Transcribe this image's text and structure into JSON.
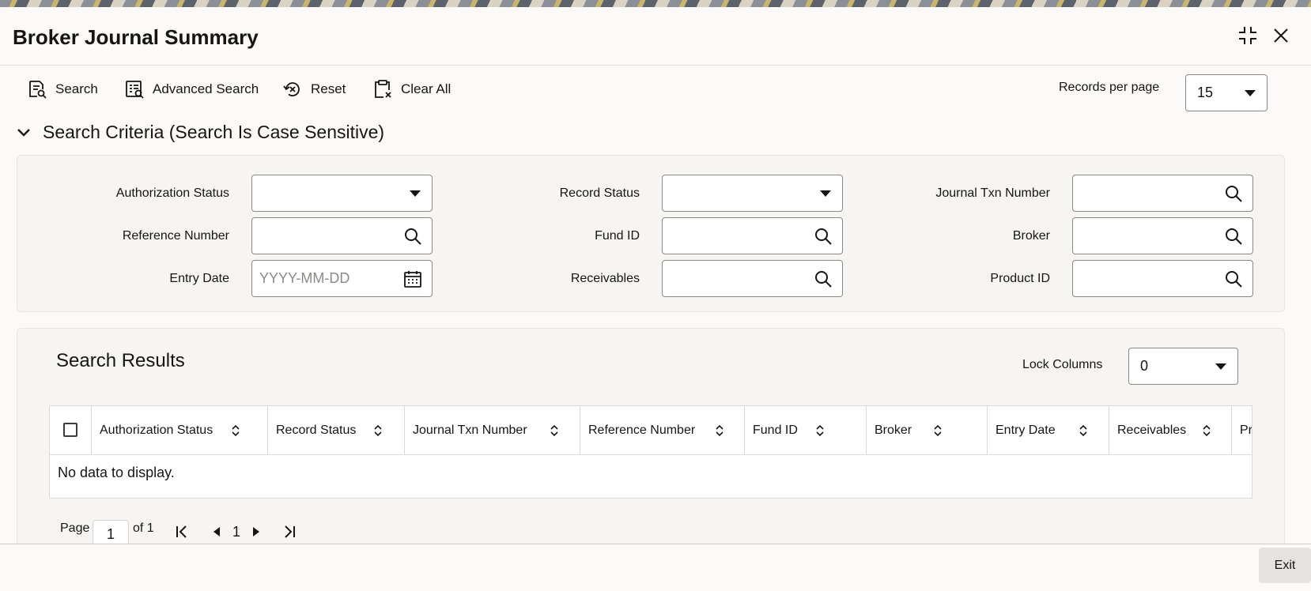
{
  "window": {
    "title": "Broker Journal Summary"
  },
  "toolbar": {
    "search_label": "Search",
    "advanced_search_label": "Advanced Search",
    "reset_label": "Reset",
    "clear_all_label": "Clear All",
    "records_per_page_label": "Records per page",
    "records_per_page_value": "15"
  },
  "search_criteria": {
    "header": "Search Criteria (Search Is Case Sensitive)",
    "fields": {
      "authorization_status": "Authorization Status",
      "record_status": "Record Status",
      "journal_txn_number": "Journal Txn Number",
      "reference_number": "Reference Number",
      "fund_id": "Fund ID",
      "broker": "Broker",
      "entry_date": "Entry Date",
      "entry_date_placeholder": "YYYY-MM-DD",
      "receivables": "Receivables",
      "product_id": "Product ID"
    }
  },
  "results": {
    "title": "Search Results",
    "lock_columns_label": "Lock Columns",
    "lock_columns_value": "0",
    "columns": [
      "Authorization Status",
      "Record Status",
      "Journal Txn Number",
      "Reference Number",
      "Fund ID",
      "Broker",
      "Entry Date",
      "Receivables",
      "Pr"
    ],
    "empty_message": "No data to display."
  },
  "pagination": {
    "page_label": "Page",
    "current_page": "1",
    "of_label": "of 1",
    "page_number": "1"
  },
  "footer": {
    "exit_label": "Exit"
  }
}
